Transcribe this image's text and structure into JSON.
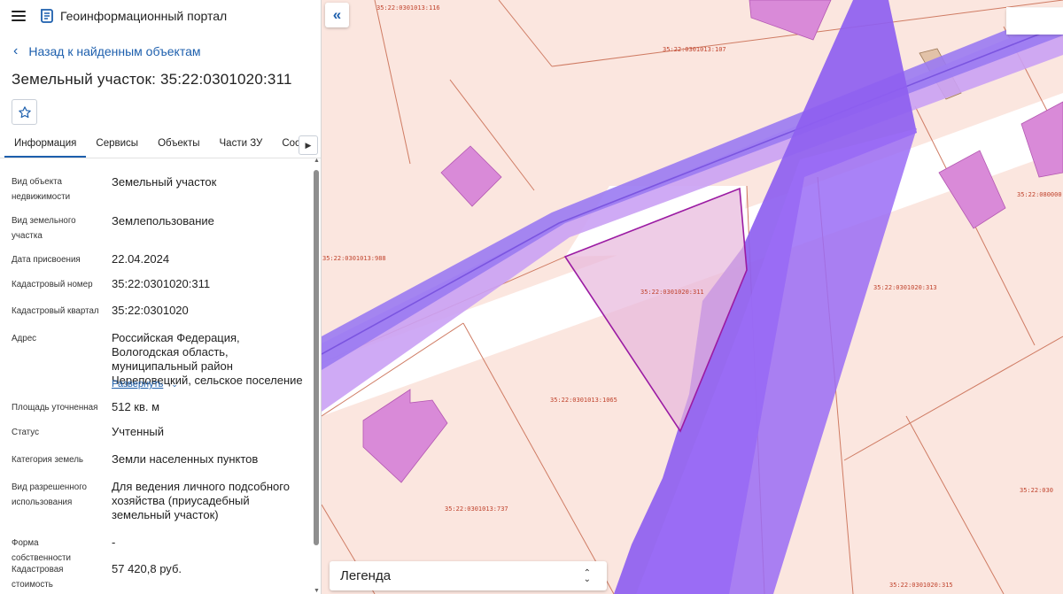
{
  "app": {
    "title": "Геоинформационный портал",
    "menu_icon": "hamburger-menu-icon",
    "logo_icon": "portal-logo-icon"
  },
  "nav": {
    "back_label": "Назад к найденным объектам"
  },
  "object": {
    "title": "Земельный участок: 35:22:0301020:311",
    "favorite_icon": "star-icon"
  },
  "tabs": [
    {
      "label": "Информация",
      "active": true
    },
    {
      "label": "Сервисы"
    },
    {
      "label": "Объекты"
    },
    {
      "label": "Части ЗУ"
    },
    {
      "label": "Состав"
    }
  ],
  "props": {
    "kind": {
      "label": "Вид объекта недвижимости",
      "value": "Земельный участок"
    },
    "land_kind": {
      "label": "Вид земельного участка",
      "value": "Землепользование"
    },
    "assigned": {
      "label": "Дата присвоения",
      "value": "22.04.2024"
    },
    "cad_num": {
      "label": "Кадастровый номер",
      "value": "35:22:0301020:311"
    },
    "quarter": {
      "label": "Кадастровый квартал",
      "value": "35:22:0301020"
    },
    "address": {
      "label": "Адрес",
      "value": "Российская Федерация, Вологодская область, муниципальный район Череповецкий, сельское поселение",
      "expand": "Развернуть"
    },
    "area": {
      "label": "Площадь уточненная",
      "value": "512 кв. м"
    },
    "status": {
      "label": "Статус",
      "value": "Учтенный"
    },
    "category": {
      "label": "Категория земель",
      "value": "Земли населенных пунктов"
    },
    "use": {
      "label": "Вид разрешенного использования",
      "value": "Для ведения личного подсобного хозяйства (приусадебный земельный участок)"
    },
    "ownership": {
      "label": "Форма собственности",
      "value": "-"
    },
    "value": {
      "label": "Кадастровая стоимость",
      "value": "57 420,8 руб."
    }
  },
  "map": {
    "labels": {
      "l116": "35:22:0301013:116",
      "l107": "35:22:0301013:107",
      "l988": "35:22:0301013:988",
      "l311": "35:22:0301020:311",
      "l313": "35:22:0301020:313",
      "l1065": "35:22:0301013:1065",
      "l737": "35:22:0301013:737",
      "l315": "35:22:0301020:315",
      "l080": "35:22:080000",
      "l030": "35:22:030"
    },
    "legend_label": "Легенда",
    "colors": {
      "parcel_fill": "#fbe6df",
      "parcel_line": "#cf7b63",
      "zone_violet": "#9a6cf0",
      "building": "#d98ad8",
      "selected": "#9b1ba3"
    }
  }
}
